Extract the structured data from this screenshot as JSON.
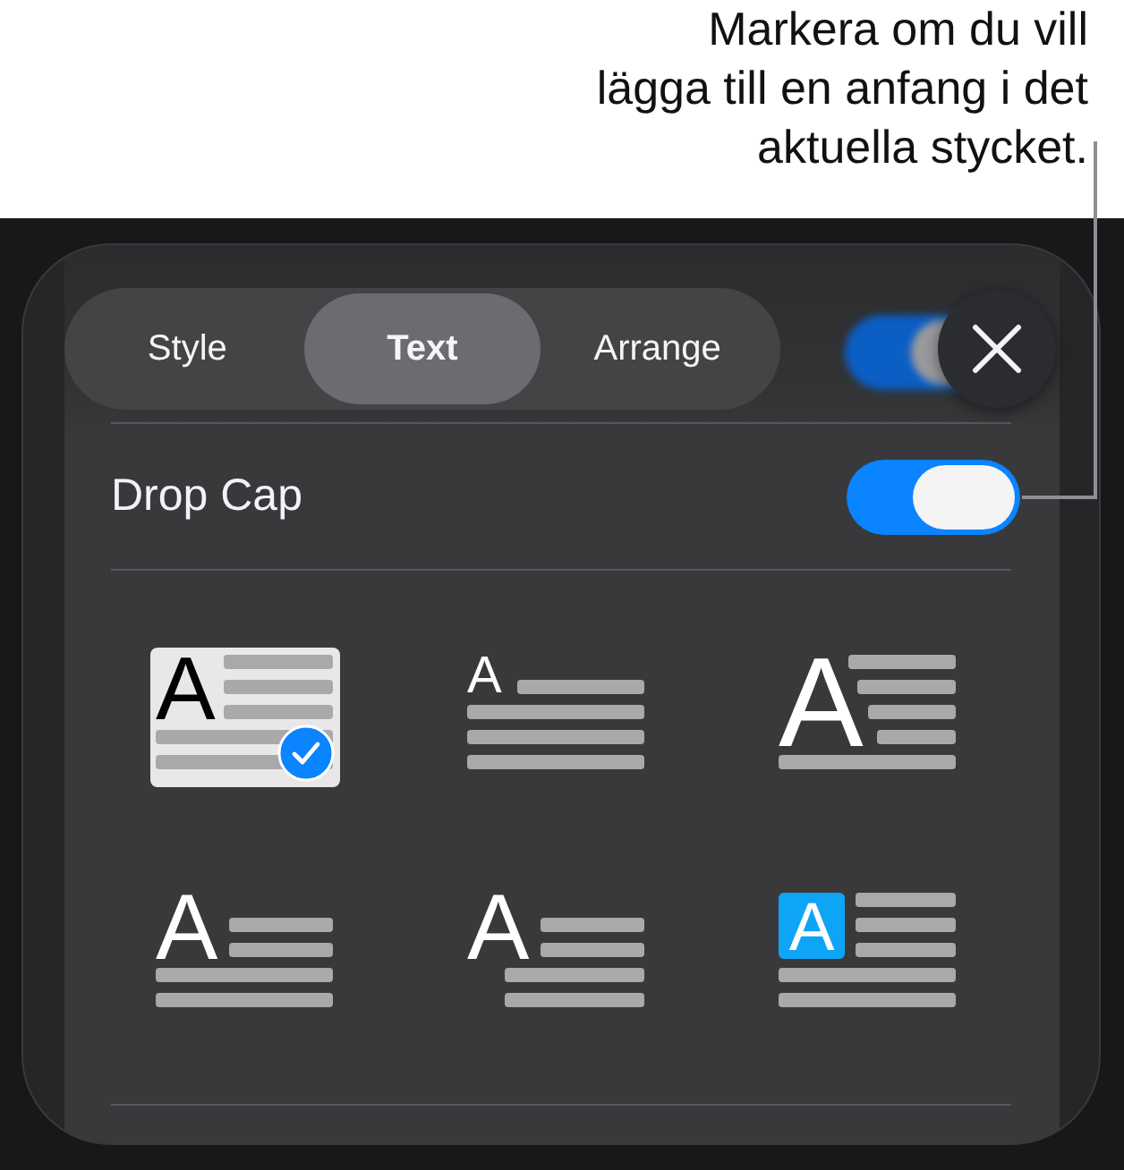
{
  "callout": {
    "text": "Markera om du vill\nlägga till en anfang i det\naktuella stycket."
  },
  "tabs": [
    {
      "label": "Style",
      "selected": false
    },
    {
      "label": "Text",
      "selected": true
    },
    {
      "label": "Arrange",
      "selected": false
    }
  ],
  "drop_cap": {
    "label": "Drop Cap",
    "on": true
  },
  "styles": [
    {
      "kind": "three-line",
      "letter": "A",
      "selected": true
    },
    {
      "kind": "raised",
      "letter": "A",
      "selected": false
    },
    {
      "kind": "four-line",
      "letter": "A",
      "selected": false
    },
    {
      "kind": "two-line",
      "letter": "A",
      "selected": false
    },
    {
      "kind": "hanging",
      "letter": "A",
      "selected": false
    },
    {
      "kind": "boxed",
      "letter": "A",
      "selected": false
    }
  ]
}
